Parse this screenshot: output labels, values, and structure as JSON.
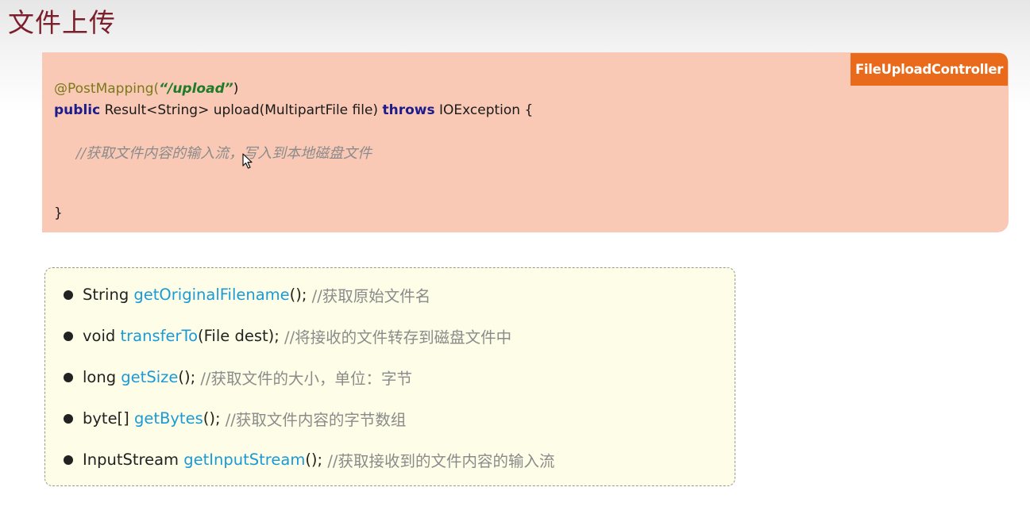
{
  "slide": {
    "title": "文件上传"
  },
  "code_panel": {
    "class_tag": "FileUploadController",
    "line1": {
      "annotation": "@PostMapping(",
      "path": "“/upload”",
      "close": ")"
    },
    "line2": {
      "kw_public": "public",
      "signature": " Result<String> upload(MultipartFile file) ",
      "kw_throws": "throws",
      "tail": " IOException {"
    },
    "comment": "//获取文件内容的输入流，写入到本地磁盘文件",
    "closing_brace": "}"
  },
  "api_list": {
    "items": [
      {
        "return_type": "String ",
        "method": "getOriginalFilename",
        "args": "(); ",
        "comment": "//获取原始文件名"
      },
      {
        "return_type": "void ",
        "method": "transferTo",
        "args": "(File dest); ",
        "comment": "//将接收的文件转存到磁盘文件中"
      },
      {
        "return_type": "long ",
        "method": "getSize",
        "args": "(); ",
        "comment": "//获取文件的大小，单位：字节"
      },
      {
        "return_type": "byte[] ",
        "method": "getBytes",
        "args": "(); ",
        "comment": "//获取文件内容的字节数组"
      },
      {
        "return_type": "InputStream ",
        "method": "getInputStream",
        "args": "(); ",
        "comment": "//获取接收到的文件内容的输入流"
      }
    ]
  },
  "colors": {
    "title": "#7b1f2c",
    "code_panel_bg": "#f9c9b5",
    "class_tag_bg": "#ea6a1b",
    "api_box_bg": "#fefee8",
    "method": "#1a9ad6",
    "keyword": "#1c1c8c",
    "string": "#1e7b28"
  },
  "icons": {
    "cursor": "mouse-pointer-icon",
    "bullet": "bullet-dot-icon"
  }
}
